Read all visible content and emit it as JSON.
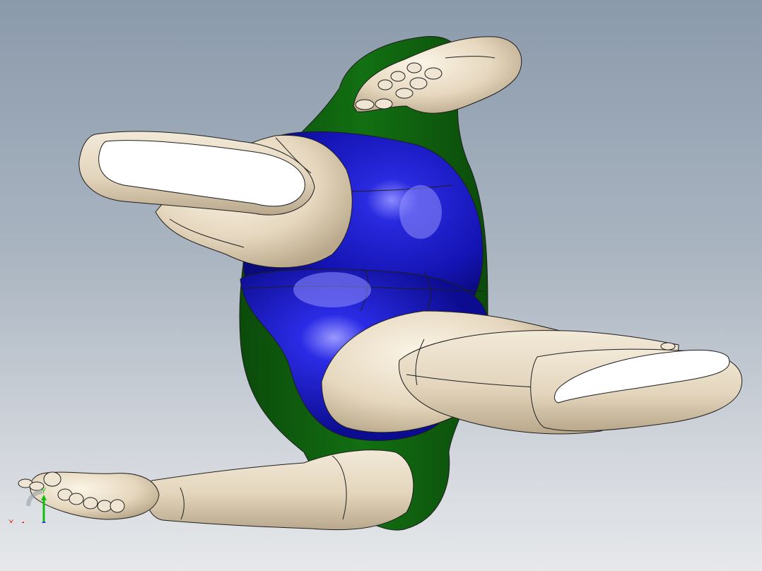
{
  "viewport": {
    "background_top": "#8b9aab",
    "background_bottom": "#e6e8ea"
  },
  "model": {
    "colors": {
      "skin": "#e9ddc7",
      "skin_shadow": "#b9a88b",
      "leotard": "#1212b0",
      "leotard_highlight": "#7b7bff",
      "torso_back": "#0f5c0f",
      "edge": "#1e1e1e",
      "shoe_sole": "#ffffff"
    }
  },
  "triad": {
    "x_label": "X",
    "y_label": "Y",
    "x_color": "#e01010",
    "y_color": "#10c010",
    "z_color": "#2030e0"
  }
}
